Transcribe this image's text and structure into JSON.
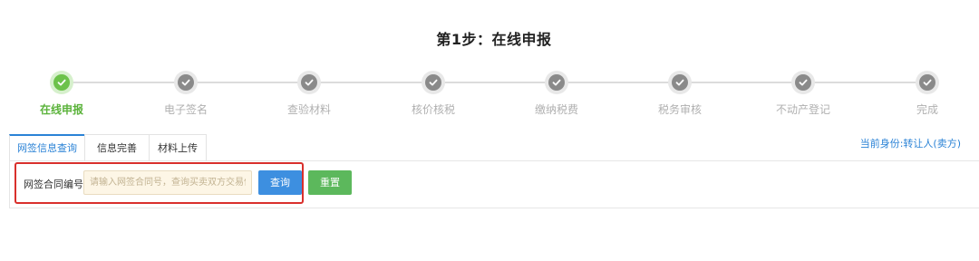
{
  "page": {
    "title": "第1步：在线申报"
  },
  "steps": [
    {
      "label": "在线申报",
      "status": "done"
    },
    {
      "label": "电子签名",
      "status": "pending"
    },
    {
      "label": "查验材料",
      "status": "pending"
    },
    {
      "label": "核价核税",
      "status": "pending"
    },
    {
      "label": "缴纳税费",
      "status": "pending"
    },
    {
      "label": "税务审核",
      "status": "pending"
    },
    {
      "label": "不动产登记",
      "status": "pending"
    },
    {
      "label": "完成",
      "status": "pending"
    }
  ],
  "tabs": [
    {
      "label": "网签信息查询",
      "active": true
    },
    {
      "label": "信息完善",
      "active": false
    },
    {
      "label": "材料上传",
      "active": false
    }
  ],
  "identity": {
    "text": "当前身份:转让人(卖方)"
  },
  "form": {
    "contract_label": "网签合同编号",
    "contract_placeholder": "请输入网签合同号，查询买卖双方交易信息",
    "contract_value": "",
    "query_label": "查询",
    "reset_label": "重置"
  },
  "colors": {
    "accent": "#2b83d6",
    "done": "#6cc24a",
    "pending": "#8a8a8a",
    "highlight": "#d9302c",
    "reset_button": "#5cb85c"
  },
  "icons": {
    "step_marker": "check-icon"
  }
}
